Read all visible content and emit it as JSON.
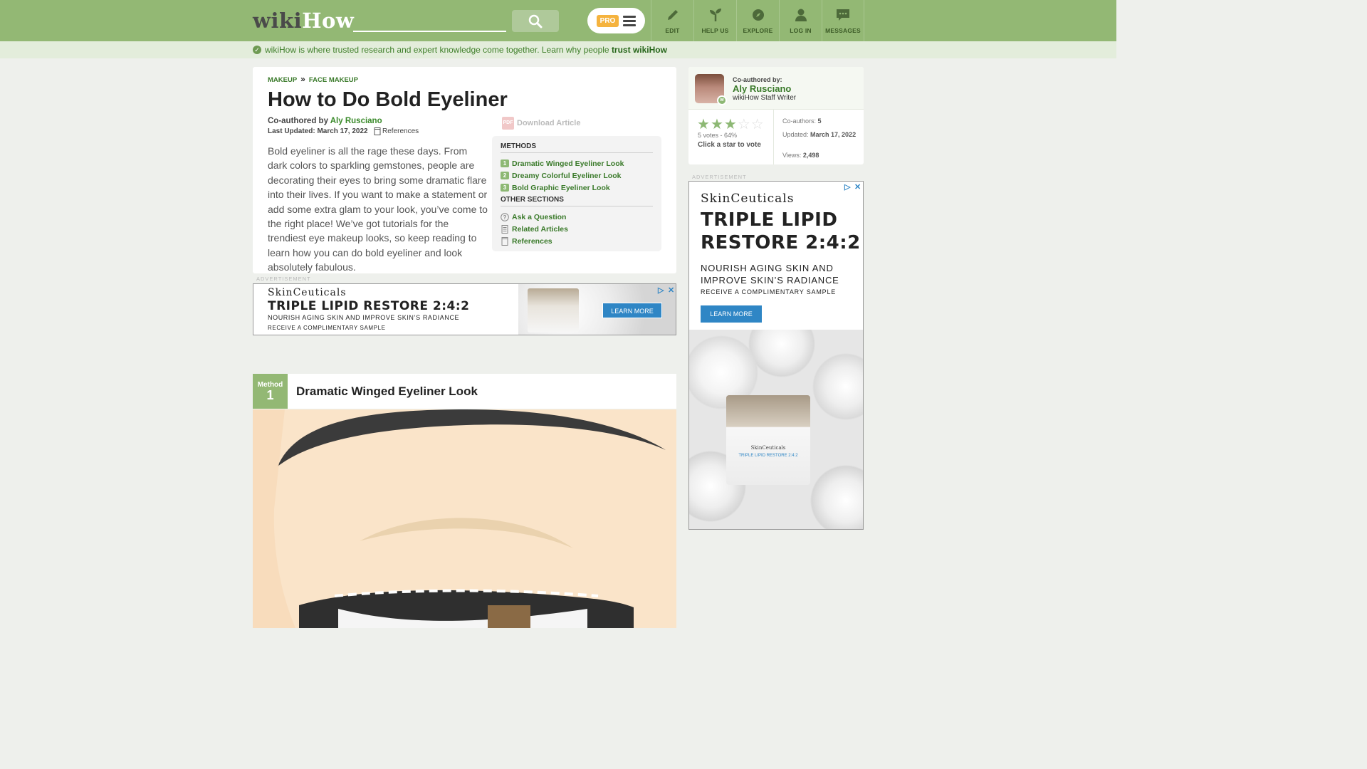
{
  "header": {
    "logo_wiki": "wiki",
    "logo_how": "How",
    "search_placeholder": "",
    "pro_label": "PRO",
    "nav": [
      {
        "label": "EDIT",
        "icon": "pencil-icon"
      },
      {
        "label": "HELP US",
        "icon": "sprout-icon"
      },
      {
        "label": "EXPLORE",
        "icon": "compass-icon"
      },
      {
        "label": "LOG IN",
        "icon": "user-icon"
      },
      {
        "label": "MESSAGES",
        "icon": "chat-icon"
      }
    ]
  },
  "trust_bar": {
    "text": "wikiHow is where trusted research and expert knowledge come together. Learn why people ",
    "link": "trust wikiHow"
  },
  "article": {
    "breadcrumbs": [
      "MAKEUP",
      "FACE MAKEUP"
    ],
    "breadcrumb_sep": "»",
    "title": "How to Do Bold Eyeliner",
    "coauthored_prefix": "Co-authored by ",
    "author": "Aly Rusciano",
    "last_updated": "Last Updated: March 17, 2022",
    "references_label": "References",
    "download_label": "Download Article",
    "pdf_label": "PDF",
    "intro": "Bold eyeliner is all the rage these days. From dark colors to sparkling gemstones, people are decorating their eyes to bring some dramatic flare into their lives. If you want to make a statement or add some extra glam to your look, you’ve come to the right place! We’ve got tutorials for the trendiest eye makeup looks, so keep reading to learn how you can do bold eyeliner and look absolutely fabulous."
  },
  "toc": {
    "methods_heading": "METHODS",
    "methods": [
      {
        "num": "1",
        "label": "Dramatic Winged Eyeliner Look"
      },
      {
        "num": "2",
        "label": "Dreamy Colorful Eyeliner Look"
      },
      {
        "num": "3",
        "label": "Bold Graphic Eyeliner Look"
      }
    ],
    "other_heading": "OTHER SECTIONS",
    "other": [
      {
        "label": "Ask a Question",
        "icon": "question-icon"
      },
      {
        "label": "Related Articles",
        "icon": "document-icon"
      },
      {
        "label": "References",
        "icon": "bookmark-icon"
      }
    ]
  },
  "ad_label": "ADVERTISEMENT",
  "ad_banner": {
    "brand": "SkinCeuticals",
    "headline": "TRIPLE LIPID RESTORE 2:4:2",
    "sub": "NOURISH AGING SKIN AND IMPROVE SKIN’S RADIANCE",
    "sub2": "RECEIVE A COMPLIMENTARY SAMPLE",
    "cta": "LEARN MORE"
  },
  "method1": {
    "tag": "Method",
    "num": "1",
    "title": "Dramatic Winged Eyeliner Look"
  },
  "sidebar": {
    "coauthored_label": "Co-authored by:",
    "author": "Aly Rusciano",
    "role": "wikiHow Staff Writer",
    "rating_stars_filled": 3,
    "rating_stars_total": 5,
    "votes": "5 votes - 64%",
    "click_vote": "Click a star to vote",
    "coauthors_label": "Co-authors: ",
    "coauthors_value": "5",
    "updated_label": "Updated: ",
    "updated_value": "March 17, 2022",
    "views_label": "Views: ",
    "views_value": "2,498"
  },
  "ad_side": {
    "brand": "SkinCeuticals",
    "headline": "TRIPLE LIPID RESTORE 2:4:2",
    "sub": "NOURISH AGING SKIN AND IMPROVE SKIN’S RADIANCE",
    "sub2": "RECEIVE A COMPLIMENTARY SAMPLE",
    "cta": "LEARN MORE",
    "jar_brand": "SkinCeuticals",
    "jar_product": "TRIPLE LIPID RESTORE 2:4:2"
  },
  "colors": {
    "header_green": "#93b874",
    "link_green": "#3a7a2a",
    "ad_blue": "#2f86c5",
    "pro_orange": "#f5b33e"
  }
}
